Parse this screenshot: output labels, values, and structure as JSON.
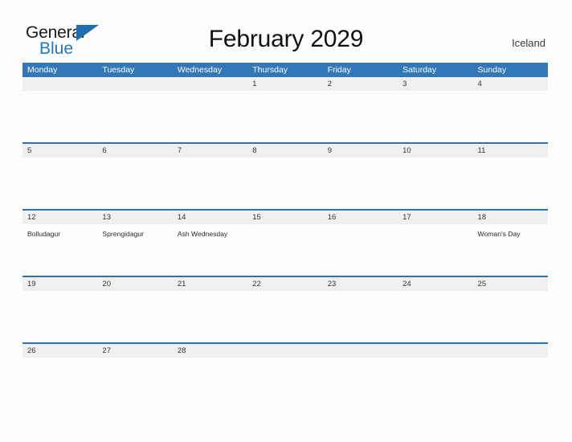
{
  "brand": {
    "name_part1": "General",
    "name_part2": "Blue",
    "color_dark": "#1a1a1a",
    "color_blue": "#2079c4"
  },
  "header": {
    "title": "February 2029",
    "country": "Iceland"
  },
  "theme": {
    "header_blue": "#3277b7",
    "rule_blue": "#2e74b5",
    "daynum_bg": "#f0f0f0",
    "page_bg": "#fdfdfd"
  },
  "weekdays": [
    "Monday",
    "Tuesday",
    "Wednesday",
    "Thursday",
    "Friday",
    "Saturday",
    "Sunday"
  ],
  "weeks": [
    {
      "days": [
        {
          "num": "",
          "event": ""
        },
        {
          "num": "",
          "event": ""
        },
        {
          "num": "",
          "event": ""
        },
        {
          "num": "1",
          "event": ""
        },
        {
          "num": "2",
          "event": ""
        },
        {
          "num": "3",
          "event": ""
        },
        {
          "num": "4",
          "event": ""
        }
      ]
    },
    {
      "days": [
        {
          "num": "5",
          "event": ""
        },
        {
          "num": "6",
          "event": ""
        },
        {
          "num": "7",
          "event": ""
        },
        {
          "num": "8",
          "event": ""
        },
        {
          "num": "9",
          "event": ""
        },
        {
          "num": "10",
          "event": ""
        },
        {
          "num": "11",
          "event": ""
        }
      ]
    },
    {
      "days": [
        {
          "num": "12",
          "event": "Bolludagur"
        },
        {
          "num": "13",
          "event": "Sprengidagur"
        },
        {
          "num": "14",
          "event": "Ash Wednesday"
        },
        {
          "num": "15",
          "event": ""
        },
        {
          "num": "16",
          "event": ""
        },
        {
          "num": "17",
          "event": ""
        },
        {
          "num": "18",
          "event": "Woman's Day"
        }
      ]
    },
    {
      "days": [
        {
          "num": "19",
          "event": ""
        },
        {
          "num": "20",
          "event": ""
        },
        {
          "num": "21",
          "event": ""
        },
        {
          "num": "22",
          "event": ""
        },
        {
          "num": "23",
          "event": ""
        },
        {
          "num": "24",
          "event": ""
        },
        {
          "num": "25",
          "event": ""
        }
      ]
    },
    {
      "days": [
        {
          "num": "26",
          "event": ""
        },
        {
          "num": "27",
          "event": ""
        },
        {
          "num": "28",
          "event": ""
        },
        {
          "num": "",
          "event": ""
        },
        {
          "num": "",
          "event": ""
        },
        {
          "num": "",
          "event": ""
        },
        {
          "num": "",
          "event": ""
        }
      ]
    }
  ]
}
